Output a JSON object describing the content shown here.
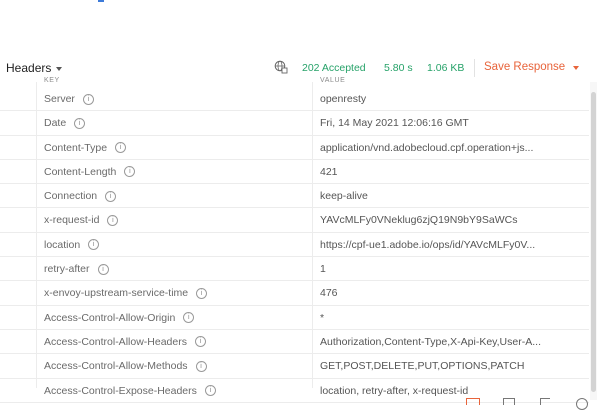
{
  "toolbar": {
    "tab_label": "Headers",
    "status": "202 Accepted",
    "time": "5.80 s",
    "size": "1.06 KB",
    "save_label": "Save Response"
  },
  "table": {
    "col_key": "KEY",
    "col_value": "VALUE",
    "rows": [
      {
        "key": "Server",
        "value": "openresty"
      },
      {
        "key": "Date",
        "value": "Fri, 14 May 2021 12:06:16 GMT"
      },
      {
        "key": "Content-Type",
        "value": "application/vnd.adobecloud.cpf.operation+js..."
      },
      {
        "key": "Content-Length",
        "value": "421"
      },
      {
        "key": "Connection",
        "value": "keep-alive"
      },
      {
        "key": "x-request-id",
        "value": "YAVcMLFy0VNeklug6zjQ19N9bY9SaWCs"
      },
      {
        "key": "location",
        "value": "https://cpf-ue1.adobe.io/ops/id/YAVcMLFy0V..."
      },
      {
        "key": "retry-after",
        "value": "1"
      },
      {
        "key": "x-envoy-upstream-service-time",
        "value": "476"
      },
      {
        "key": "Access-Control-Allow-Origin",
        "value": "*"
      },
      {
        "key": "Access-Control-Allow-Headers",
        "value": "Authorization,Content-Type,X-Api-Key,User-A..."
      },
      {
        "key": "Access-Control-Allow-Methods",
        "value": "GET,POST,DELETE,PUT,OPTIONS,PATCH"
      },
      {
        "key": "Access-Control-Expose-Headers",
        "value": "location, retry-after, x-request-id"
      }
    ]
  },
  "icons": {
    "network": "globe-network-icon",
    "info": "info-icon",
    "dropdown": "chevron-down-icon"
  },
  "colors": {
    "status_green": "#26a269",
    "save_orange": "#e8643b"
  }
}
